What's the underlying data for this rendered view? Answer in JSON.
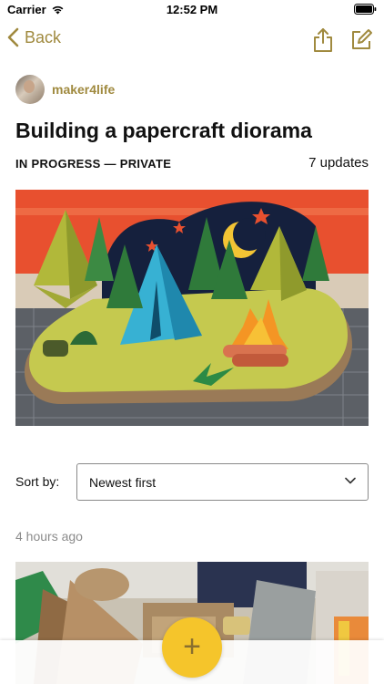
{
  "status_bar": {
    "carrier": "Carrier",
    "time": "12:52 PM"
  },
  "nav": {
    "back_label": "Back",
    "back_icon": "chevron-left-icon",
    "share_icon": "share-icon",
    "edit_icon": "edit-icon"
  },
  "author": {
    "username": "maker4life"
  },
  "project": {
    "title": "Building a papercraft diorama",
    "status": "IN PROGRESS — PRIVATE",
    "updates_count": "7 updates"
  },
  "sort": {
    "label": "Sort by:",
    "selected": "Newest first"
  },
  "feed": {
    "timestamp": "4 hours ago"
  },
  "fab": {
    "label": "+"
  },
  "colors": {
    "accent": "#a08a3f",
    "fab": "#f5c52b",
    "muted": "#8b8b8b"
  }
}
